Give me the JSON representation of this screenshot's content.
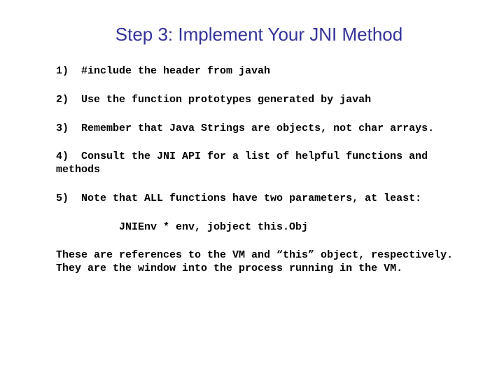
{
  "title": "Step 3: Implement Your JNI Method",
  "items": [
    {
      "num": "1)",
      "text": "#include the header from javah"
    },
    {
      "num": "2)",
      "text": "Use the function prototypes generated by javah"
    },
    {
      "num": "3)",
      "text": "Remember that Java Strings are objects, not char arrays."
    },
    {
      "num": "4)",
      "text": "Consult the JNI API for a list of helpful functions and methods"
    },
    {
      "num": "5)",
      "text": "Note that ALL functions have two parameters, at least:"
    }
  ],
  "signature": "JNIEnv * env, jobject this.Obj",
  "footer": "These are references to the VM and “this” object, respectively.  They are the window into the process running in the VM."
}
